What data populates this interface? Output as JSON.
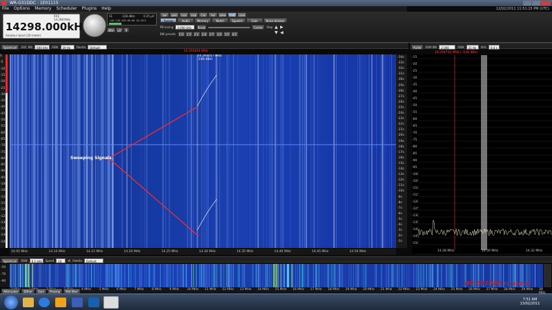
{
  "window": {
    "title": "WR-G31DDC - 1E01115",
    "clock": "12/02/2011 11:51:15 PM (UTC)"
  },
  "menu": [
    "File",
    "Options",
    "Memory",
    "Scheduler",
    "Plugins",
    "Help"
  ],
  "frequency": {
    "value": "14298.000",
    "unit": "kHz",
    "band": "Amateur band (20-meter)",
    "small_a": "RX2",
    "small_b": "14.298 MHz"
  },
  "smeter": {
    "reading": "S1",
    "dbm": "-128 dBm",
    "uv": "0.25 µV",
    "scale": "-140 -120 -100 -80 -60 -40 -20 0",
    "buttons": [
      "dBm",
      "µV",
      "S"
    ]
  },
  "modes": [
    "AM",
    "AMS",
    "LSB",
    "USB",
    "CW",
    "FM",
    "DRM",
    "DSB",
    "UDM"
  ],
  "tabs": [
    "Tuning",
    "Audio",
    "Memory",
    "Notch",
    "Squelch",
    "Gain",
    "Noise blanker"
  ],
  "tuning": {
    "pb_label": "PB tuning",
    "pb_value": "0.000 kHz",
    "reset": "Reset",
    "center": "Center",
    "step": "Step",
    "bw_label": "BW presets",
    "bw_buttons": [
      "1.0",
      "1.5",
      "2.1",
      "2.4",
      "2.7",
      "3.0",
      "3.5",
      "4.5"
    ]
  },
  "spectrum_toolbar": {
    "spectrum_btn": "Spectrum",
    "ddc_bw_label": "DDC BW",
    "ddc_bw_value": "600 kHz",
    "rbw_label": "RBW",
    "rbw_value": "19 Hz",
    "palette_label": "Palette",
    "palette_value": "Default"
  },
  "waterfall": {
    "cursor_freq": "14.291404 MHz",
    "tooltip_freq": "14.291057 MHz",
    "tooltip_dbm": "-140 dBm",
    "annotation": "Sweeping Signals",
    "y_labels": [
      "0",
      "-5",
      "-10",
      "-15",
      "-20",
      "-25",
      "-30",
      "-35",
      "-40",
      "-45",
      "-50",
      "-55",
      "-60",
      "-65",
      "-70",
      "-75",
      "-80",
      "-85",
      "-90",
      "-95",
      "-100",
      "-105",
      "-110",
      "-115",
      "-120",
      "-125",
      "-130",
      "-135",
      "-140",
      "-145"
    ],
    "time_labels": [
      "-34s",
      "-33s",
      "-32s",
      "-31s",
      "-30s",
      "-29s",
      "-28s",
      "-27s",
      "-26s",
      "-25s",
      "-24s",
      "-23s",
      "-22s",
      "-21s",
      "-20s",
      "-19s",
      "-18s",
      "-17s",
      "-16s",
      "-15s",
      "-14s",
      "-13s",
      "-12s",
      "-11s",
      "-10s",
      "-9s",
      "-8s",
      "-7s",
      "-6s",
      "-5s",
      "-4s",
      "-3s",
      "-2s",
      "-1s"
    ],
    "x_labels": [
      "14.05 MHz",
      "14.10 MHz",
      "14.15 MHz",
      "14.20 MHz",
      "14.25 MHz",
      "14.30 MHz",
      "14.35 MHz",
      "14.40 MHz",
      "14.45 MHz",
      "14.50 MHz"
    ]
  },
  "right_panel": {
    "audio_btn": "Audio",
    "dem_bw_label": "DEM BW",
    "dem_bw_value": "2.000 kHz",
    "rbw_label": "RBW",
    "rbw_value": "31 Hz",
    "avg_label": "AVG",
    "avg_value": "0.4 s",
    "cursor": "14.294752 MHz | -134 dBm",
    "y_labels": [
      "-15",
      "-20",
      "-25",
      "-30",
      "-35",
      "-40",
      "-45",
      "-50",
      "-55",
      "-60",
      "-65",
      "-70",
      "-75",
      "-80",
      "-85",
      "-90",
      "-95",
      "-100",
      "-105",
      "-110",
      "-115",
      "-120",
      "-125",
      "-130",
      "-135",
      "-140",
      "-145",
      "-150"
    ],
    "x_labels": [
      "14.28 MHz",
      "14.30 MHz",
      "14.32 MHz"
    ]
  },
  "bottom_toolbar": {
    "spectrum_btn": "Spectrum",
    "rbw_label": "RBW",
    "rbw_value": "6.1 kHz",
    "speed_label": "Speed",
    "speed_value": "10",
    "w_label": "W",
    "palette_label": "Palette",
    "palette_value": "Default",
    "marker": "14.298 MHz"
  },
  "bottom_strip": {
    "x_labels": [
      "0 MHz",
      "1 MHz",
      "2 MHz",
      "3 MHz",
      "4 MHz",
      "5 MHz",
      "6 MHz",
      "7 MHz",
      "8 MHz",
      "9 MHz",
      "10 MHz",
      "11 MHz",
      "12 MHz",
      "13 MHz",
      "14 MHz",
      "15 MHz",
      "16 MHz",
      "17 MHz",
      "18 MHz",
      "19 MHz",
      "20 MHz",
      "21 MHz",
      "22 MHz",
      "23 MHz",
      "24 MHz",
      "25 MHz",
      "26 MHz",
      "27 MHz",
      "28 MHz",
      "29 MHz",
      "30 MHz"
    ],
    "y_labels": [
      "-50",
      "-70",
      "-90"
    ]
  },
  "bottom_buttons": [
    "Attenuator",
    "Dither",
    "Gain",
    "Preamp",
    "Mid filter"
  ],
  "brand": {
    "main": "WR-G31DDC",
    "sub": "EXCALIBUR"
  },
  "taskbar": {
    "time": "7:51 AM",
    "date": "13/02/2011"
  },
  "colors": {
    "accent": "#5a7aa8",
    "waterfall": "#1a3cad",
    "sweep_line": "#ff2a2a",
    "brand": "#c21d1d"
  }
}
